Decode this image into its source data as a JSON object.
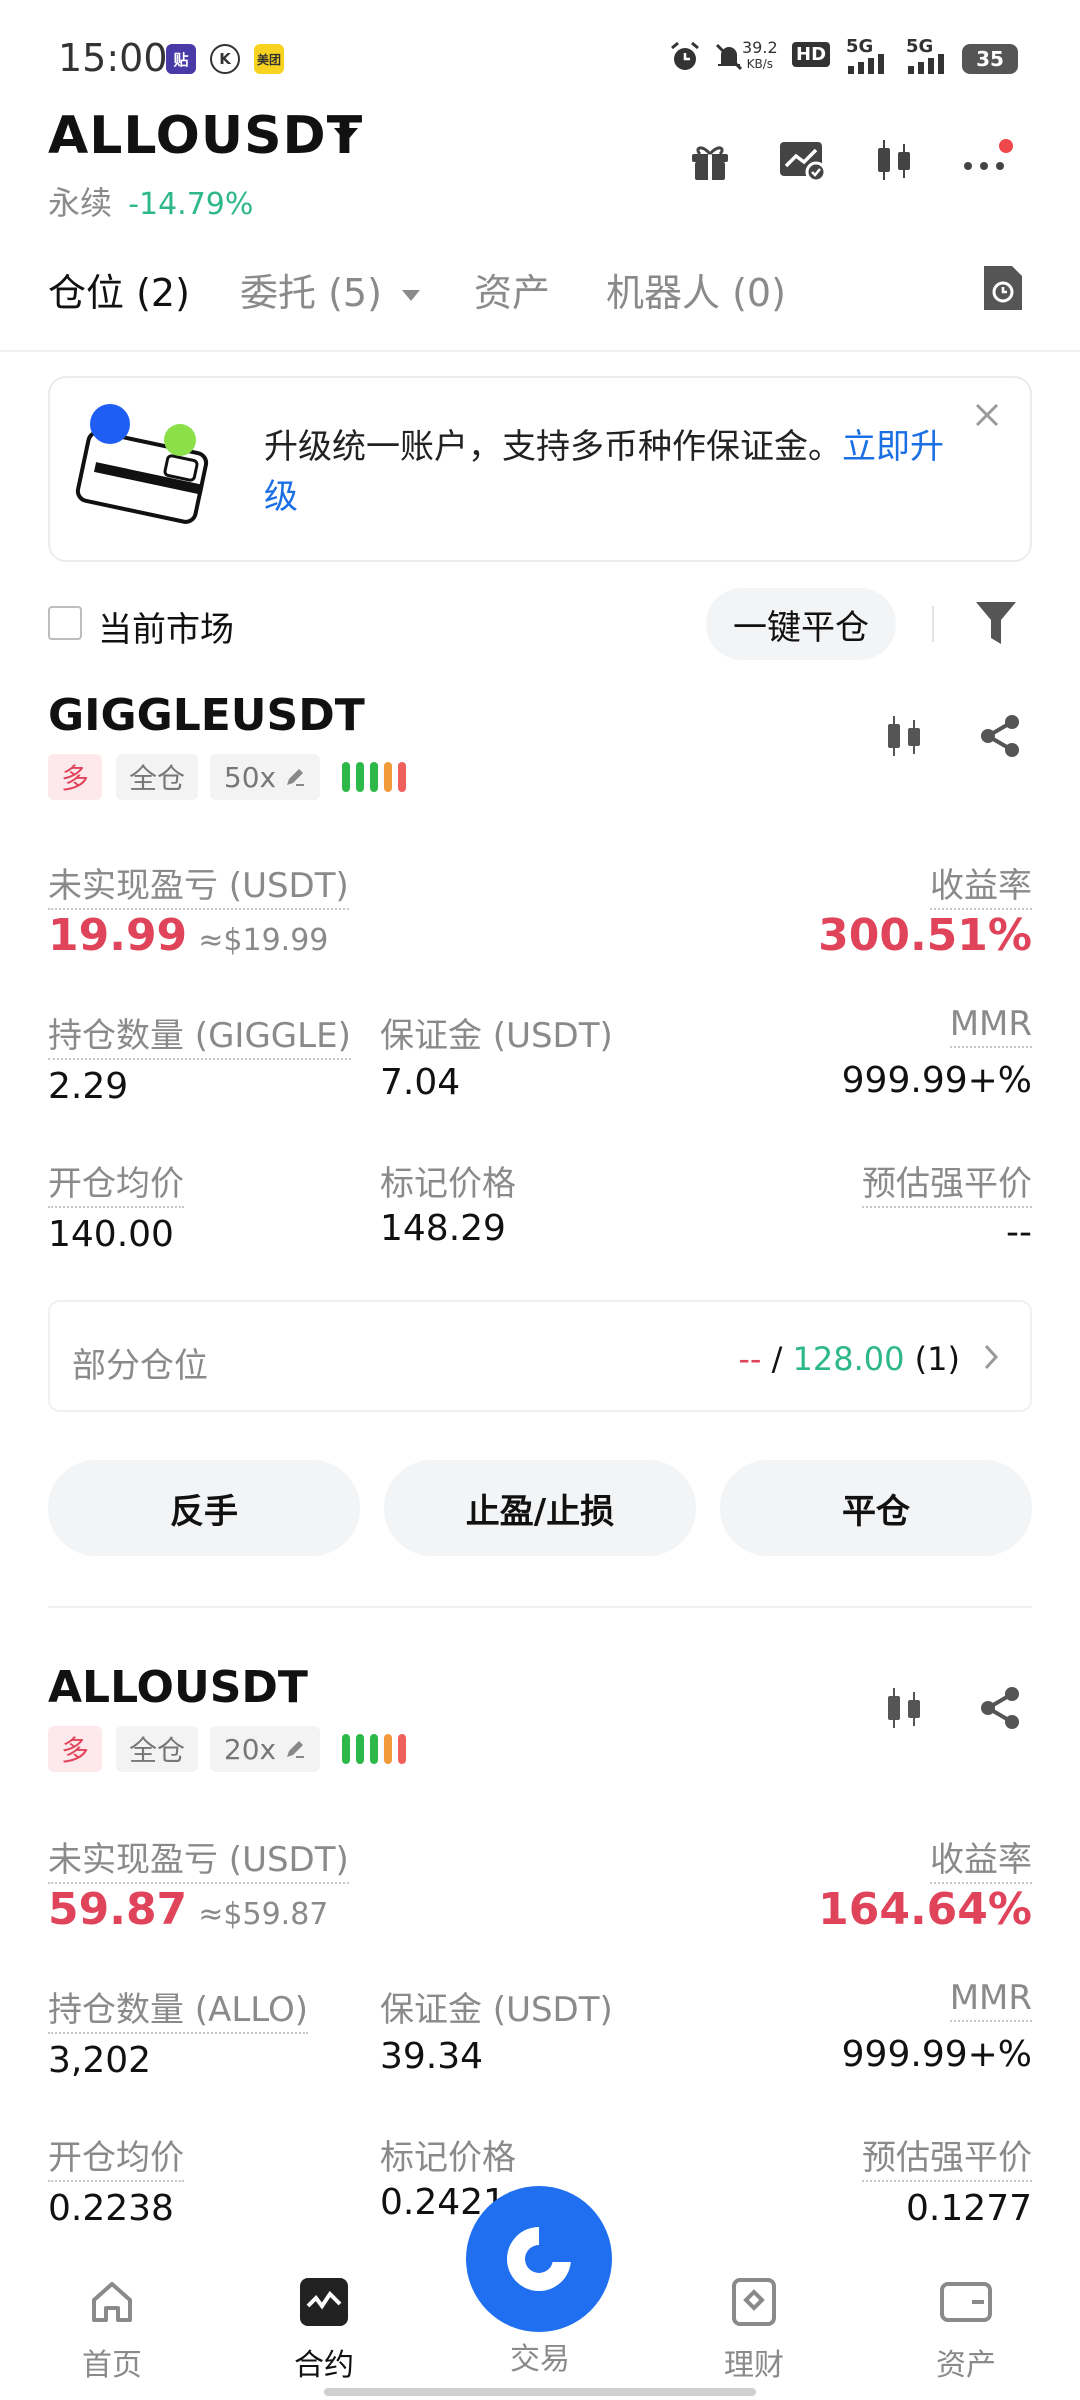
{
  "status_bar": {
    "time": "15:00",
    "app_icons": [
      "贴",
      "K",
      "美团"
    ],
    "net_speed_value": "39.2",
    "net_speed_unit": "KB/s",
    "hd": "HD",
    "sig1": "5G",
    "sig2": "5G",
    "battery": "35"
  },
  "header": {
    "symbol": "ALLOUSDT",
    "type": "永续",
    "change": "-14.79%"
  },
  "tabs": [
    {
      "label": "仓位 (2)"
    },
    {
      "label": "委托 (5)"
    },
    {
      "label": "资产"
    },
    {
      "label": "机器人 (0)"
    }
  ],
  "banner": {
    "text": "升级统一账户，支持多币种作保证金。",
    "link": "立即升级"
  },
  "filter": {
    "current_market": "当前市场",
    "close_all": "一键平仓"
  },
  "positions": [
    {
      "symbol": "GIGGLEUSDT",
      "side": "多",
      "margin_mode": "全仓",
      "leverage": "50x",
      "pnl_label": "未实现盈亏 (USDT)",
      "pnl": "19.99",
      "pnl_usd": "≈$19.99",
      "roe_label": "收益率",
      "roe": "300.51%",
      "qty_label": "持仓数量 (GIGGLE)",
      "qty": "2.29",
      "margin_label": "保证金 (USDT)",
      "margin": "7.04",
      "mmr_label": "MMR",
      "mmr": "999.99+%",
      "entry_label": "开仓均价",
      "entry": "140.00",
      "mark_label": "标记价格",
      "mark": "148.29",
      "liq_label": "预估强平价",
      "liq": "--",
      "partial_label": "部分仓位",
      "partial_a": "--",
      "partial_sep": "/",
      "partial_b": "128.00",
      "partial_count": "(1)",
      "btn_reverse": "反手",
      "btn_tpsl": "止盈/止损",
      "btn_close": "平仓"
    },
    {
      "symbol": "ALLOUSDT",
      "side": "多",
      "margin_mode": "全仓",
      "leverage": "20x",
      "pnl_label": "未实现盈亏 (USDT)",
      "pnl": "59.87",
      "pnl_usd": "≈$59.87",
      "roe_label": "收益率",
      "roe": "164.64%",
      "qty_label": "持仓数量 (ALLO)",
      "qty": "3,202",
      "margin_label": "保证金 (USDT)",
      "margin": "39.34",
      "mmr_label": "MMR",
      "mmr": "999.99+%",
      "entry_label": "开仓均价",
      "entry": "0.2238",
      "mark_label": "标记价格",
      "mark": "0.2421",
      "liq_label": "预估强平价",
      "liq": "0.1277"
    }
  ],
  "bottom_nav": [
    {
      "label": "首页",
      "icon": "home-icon"
    },
    {
      "label": "合约",
      "icon": "futures-icon"
    },
    {
      "label": "交易",
      "icon": "trade-icon"
    },
    {
      "label": "理财",
      "icon": "earn-icon"
    },
    {
      "label": "资产",
      "icon": "wallet-icon"
    }
  ],
  "colors": {
    "accent": "#1f6ff0",
    "up": "#2eb88a",
    "down": "#e0445a",
    "warn": "#f29a3a",
    "notification_dot": "#f0484a",
    "risk_bars": [
      "#2db84a",
      "#2db84a",
      "#2db84a",
      "#f29a3a",
      "#f0605a"
    ]
  }
}
